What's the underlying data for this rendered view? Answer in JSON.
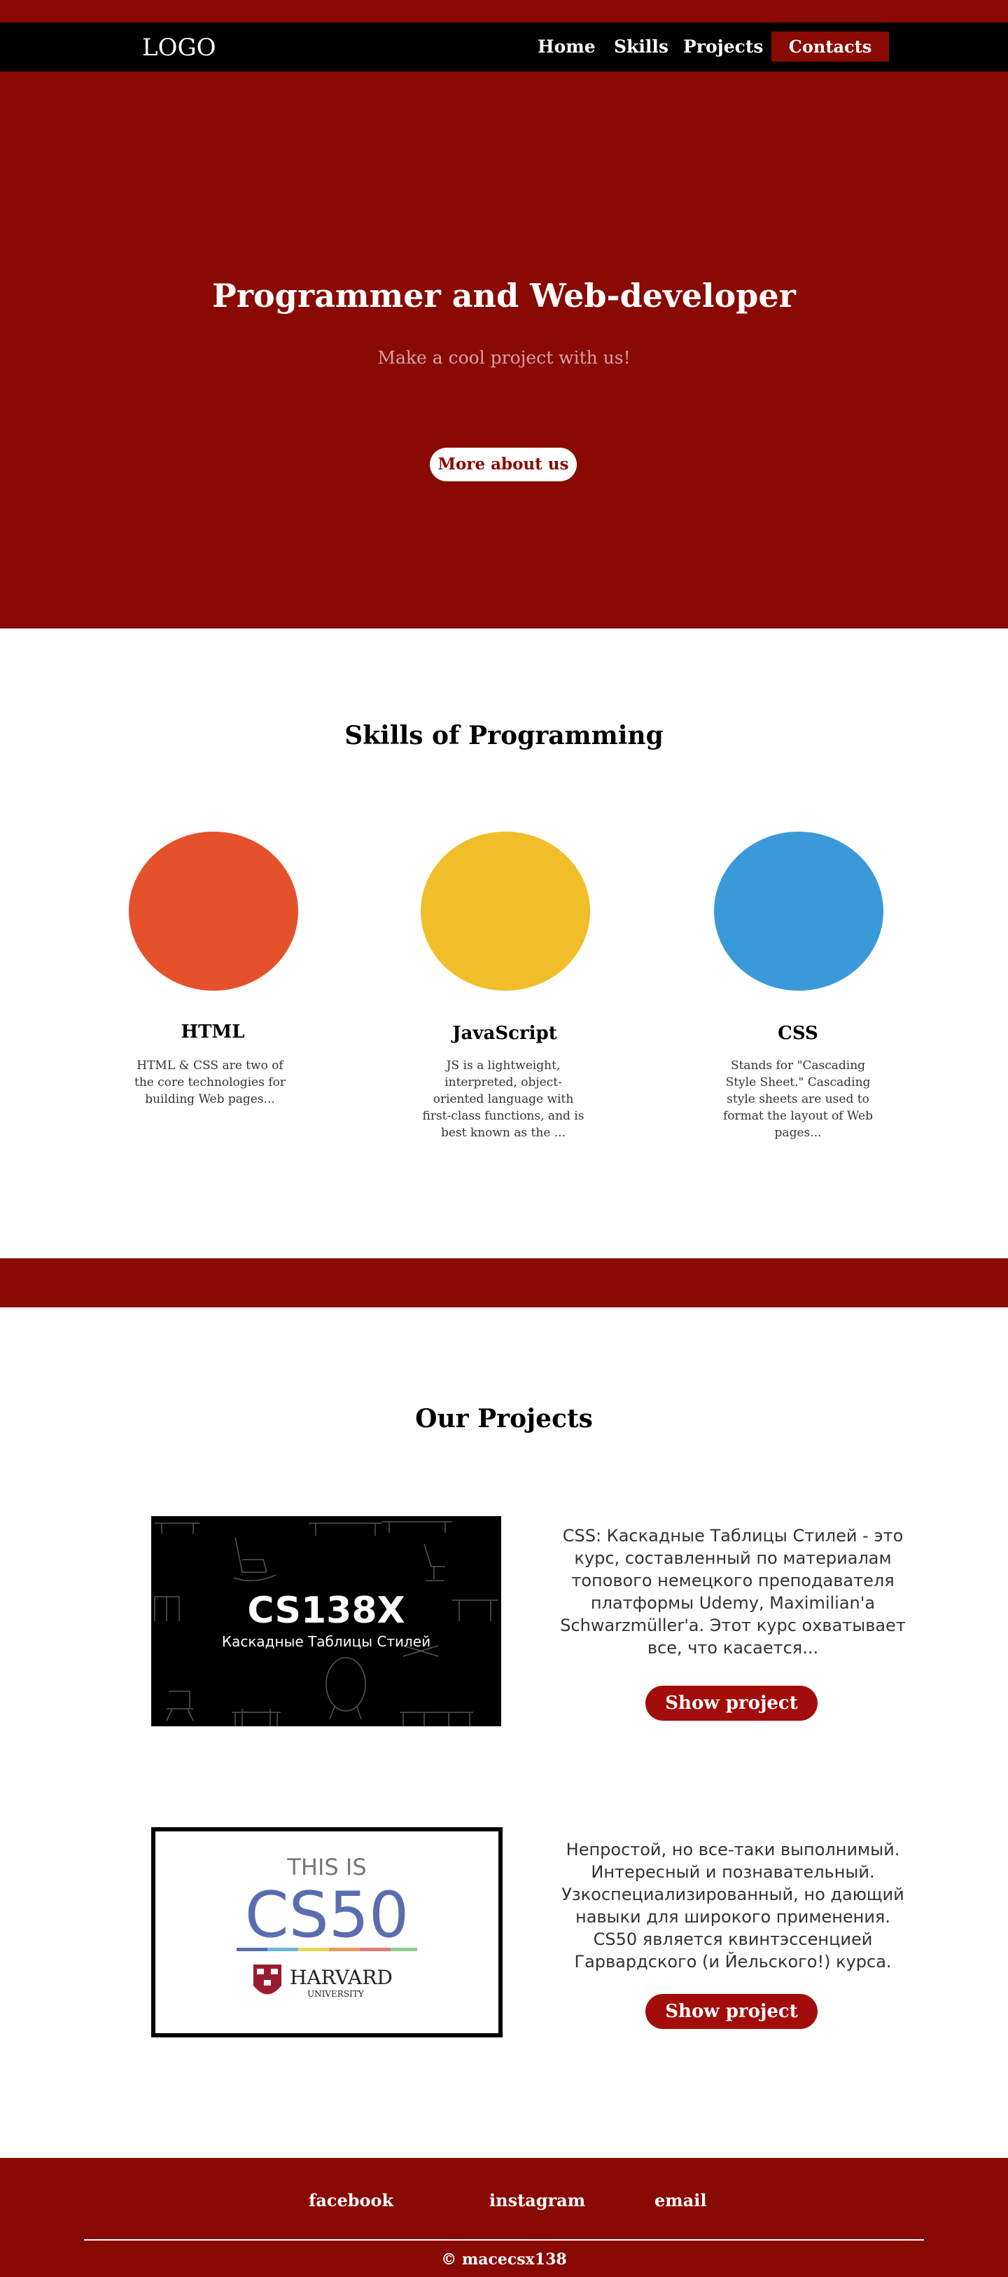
{
  "nav": {
    "logo": "LOGO",
    "links": [
      "Home",
      "Skills",
      "Projects"
    ],
    "contacts": "Contacts"
  },
  "hero": {
    "title": "Programmer and Web-developer",
    "subtitle": "Make a cool project with us!",
    "button": "More about us"
  },
  "skills": {
    "title": "Skills of Programming",
    "items": [
      {
        "name": "HTML",
        "color": "#e5512b",
        "desc": "HTML & CSS  are two of the core technologies for building Web pages..."
      },
      {
        "name": "JavaScript",
        "color": "#f0be29",
        "desc": "JS is a lightweight, interpreted, object-oriented language with first-class functions, and is best known as the ..."
      },
      {
        "name": "CSS",
        "color": "#3a9ad9",
        "desc": "Stands for \"Cascading Style Sheet.\" Cascading style sheets are used to format the layout of Web pages..."
      }
    ]
  },
  "projects": {
    "title": "Our Projects",
    "items": [
      {
        "image_title": "CS138X",
        "image_subtitle": "Каскадные  Таблицы  Стилей",
        "desc": "CSS: Каскадные Таблицы Стилей - это курс, составленный по материалам топового немецкого преподавателя платформы Udemy, Maximilian'a Schwarzmüller'a. Этот курс охватывает все, что касается...",
        "button": "Show project"
      },
      {
        "image_top": "THIS IS",
        "image_title": "CS50",
        "image_brand": "HARVARD",
        "image_brand_sub": "UNIVERSITY",
        "desc": "Непростой, но все-таки выполнимый. Интересный и познавательный. Узкоспециализированный, но дающий навыки для широкого применения. CS50 является квинтэссенцией Гарвардского (и Йельского!) курса.",
        "button": "Show project"
      }
    ]
  },
  "footer": {
    "links": [
      "facebook",
      "instagram",
      "email"
    ],
    "copyright": "© macecsx138"
  },
  "colors": {
    "brand": "#890903",
    "accent_button": "#a20d0b"
  }
}
